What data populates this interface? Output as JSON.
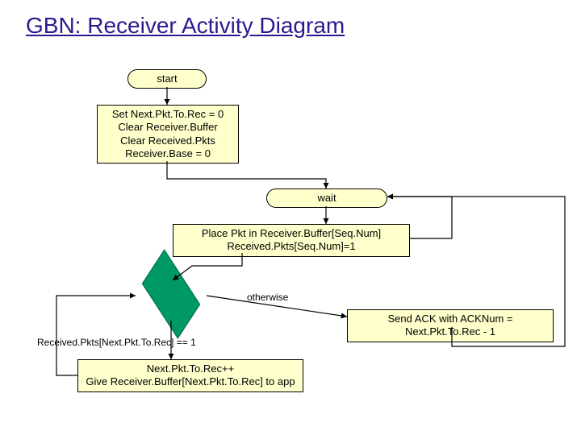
{
  "title": "GBN: Receiver Activity Diagram",
  "nodes": {
    "start": "start",
    "init_line1": "Set Next.Pkt.To.Rec = 0",
    "init_line2": "Clear Receiver.Buffer",
    "init_line3": "Clear Received.Pkts",
    "init_line4": "Receiver.Base = 0",
    "wait": "wait",
    "place_line1": "Place Pkt in Receiver.Buffer[Seq.Num]",
    "place_line2": "Received.Pkts[Seq.Num]=1",
    "otherwise": "otherwise",
    "condition": "Received.Pkts[Next.Pkt.To.Rec] == 1",
    "deliver_line1": "Next.Pkt.To.Rec++",
    "deliver_line2": "Give Receiver.Buffer[Next.Pkt.To.Rec] to app",
    "sendack": "Send ACK with ACKNum = Next.Pkt.To.Rec - 1"
  }
}
